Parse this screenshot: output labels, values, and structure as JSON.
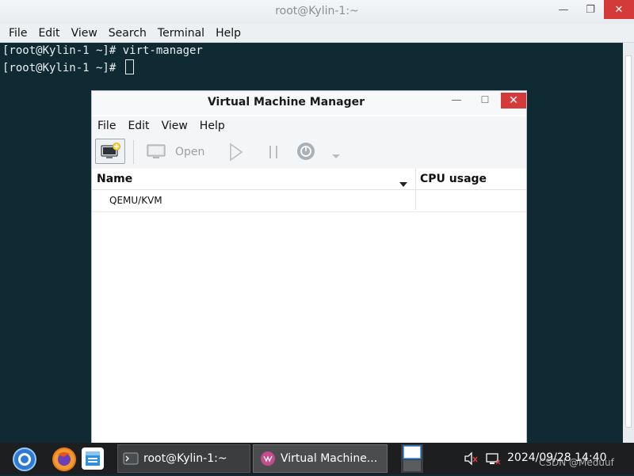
{
  "terminal": {
    "title": "root@Kylin-1:~",
    "menu": [
      "File",
      "Edit",
      "View",
      "Search",
      "Terminal",
      "Help"
    ],
    "lines": [
      "[root@Kylin-1 ~]# virt-manager",
      "[root@Kylin-1 ~]# "
    ],
    "controls": {
      "minimize": "—",
      "maximize": "❐",
      "close": "✕"
    }
  },
  "vmm": {
    "title": "Virtual Machine Manager",
    "menu": [
      "File",
      "Edit",
      "View",
      "Help"
    ],
    "toolbar": {
      "open_label": "Open"
    },
    "columns": {
      "name": "Name",
      "cpu": "CPU usage"
    },
    "rows": [
      {
        "label": "QEMU/KVM"
      }
    ],
    "controls": {
      "minimize": "—",
      "maximize": "☐",
      "close": "✕"
    }
  },
  "taskbar": {
    "tasks": [
      {
        "label": "root@Kylin-1:~"
      },
      {
        "label": "Virtual Machine..."
      }
    ],
    "clock": "2024/09/28 14:40",
    "watermark": "CSDN @Meduuf"
  },
  "colors": {
    "terminal_bg": "#0f2a33",
    "close_red": "#d43a3a",
    "taskbar_bg": "#1c1e20"
  }
}
